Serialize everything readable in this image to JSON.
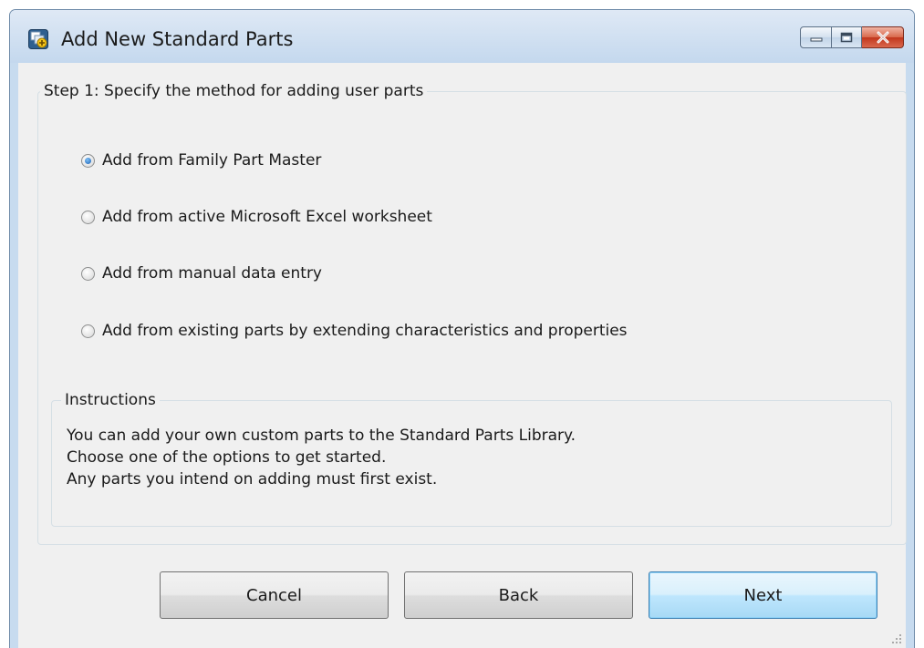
{
  "window": {
    "title": "Add New Standard Parts",
    "icon": "standard-parts-icon"
  },
  "step": {
    "legend": "Step 1: Specify the method for adding user parts",
    "options": [
      {
        "label": "Add from Family Part Master",
        "checked": true
      },
      {
        "label": "Add from active Microsoft Excel worksheet",
        "checked": false
      },
      {
        "label": "Add from manual data entry",
        "checked": false
      },
      {
        "label": "Add from existing parts by extending characteristics and properties",
        "checked": false
      }
    ]
  },
  "instructions": {
    "legend": "Instructions",
    "lines": [
      "You can add your own custom parts to the Standard Parts Library.",
      "Choose one of the options to get started.",
      "Any parts you intend on adding must first exist."
    ]
  },
  "buttons": {
    "cancel": "Cancel",
    "back": "Back",
    "next": "Next"
  },
  "colors": {
    "titlebar": "#c7dbef",
    "client": "#f0f0f0",
    "close_button": "#c2361c",
    "default_button_border": "#3c7fb1"
  }
}
